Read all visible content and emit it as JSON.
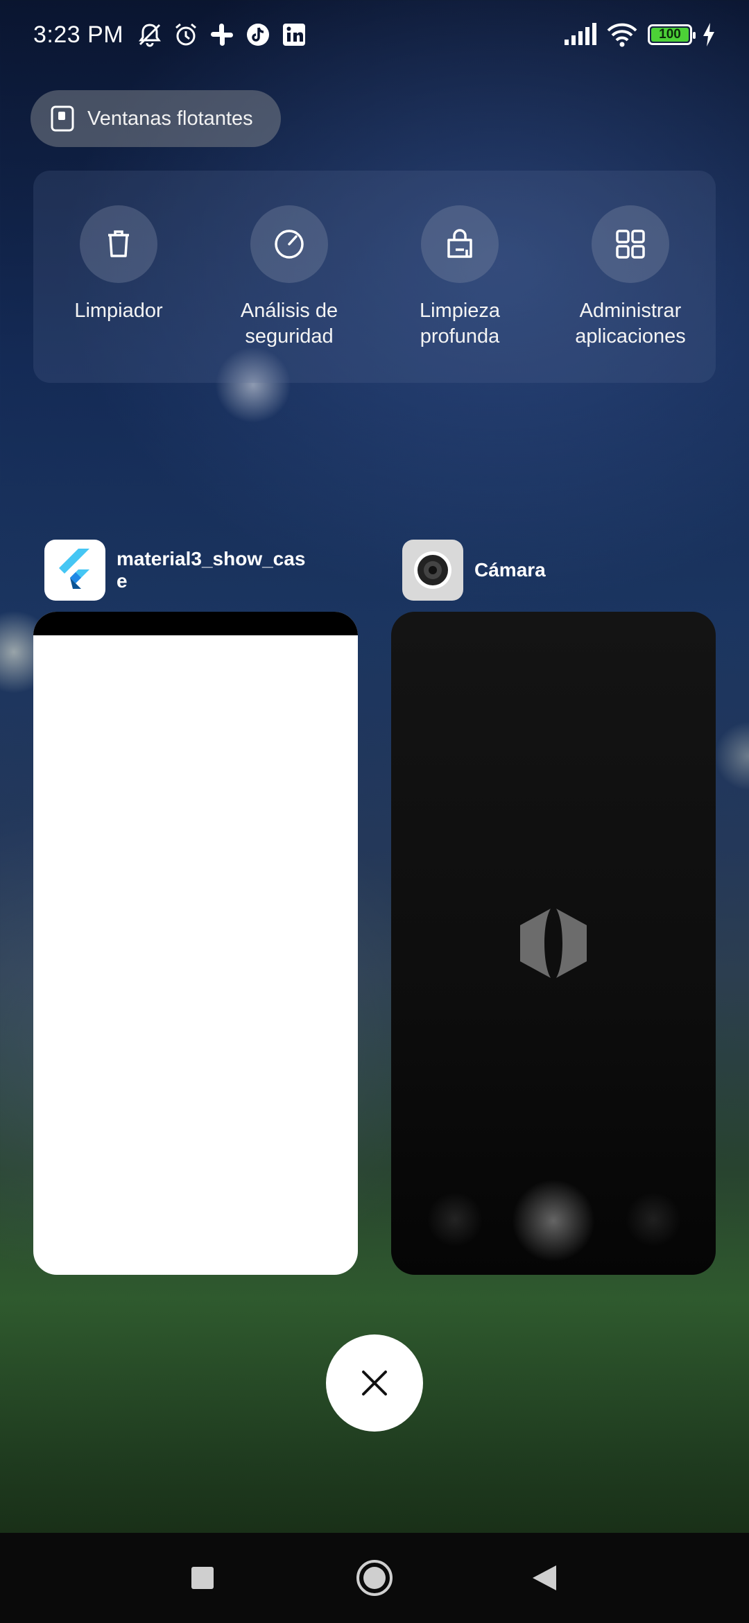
{
  "status_bar": {
    "time": "3:23 PM",
    "left_icons": [
      "bell-muted-icon",
      "alarm-icon",
      "slack-icon",
      "tiktok-icon",
      "linkedin-icon"
    ],
    "right_icons": [
      "signal-icon",
      "wifi-icon",
      "battery-icon",
      "charging-icon"
    ],
    "battery": "100",
    "battery_level": 1.0,
    "battery_color": "#4cd137"
  },
  "floating_windows": {
    "label": "Ventanas flotantes",
    "icon": "floating-window-icon"
  },
  "tools": [
    {
      "label_line1": "Limpiador",
      "label_line2": "",
      "icon": "trash-icon"
    },
    {
      "label_line1": "Análisis de",
      "label_line2": "seguridad",
      "icon": "security-scan-icon"
    },
    {
      "label_line1": "Limpieza",
      "label_line2": "profunda",
      "icon": "deep-clean-icon"
    },
    {
      "label_line1": "Administrar",
      "label_line2": "aplicaciones",
      "icon": "apps-grid-icon"
    }
  ],
  "recent_apps": [
    {
      "name_line1": "material3_show_cas",
      "name_line2": "e",
      "icon": "flutter-icon"
    },
    {
      "name_line1": "Cámara",
      "name_line2": "",
      "icon": "camera-icon"
    }
  ],
  "close_all": {
    "icon": "close-icon"
  },
  "nav": {
    "recents": "square-icon",
    "home": "circle-icon",
    "back": "triangle-back-icon"
  }
}
